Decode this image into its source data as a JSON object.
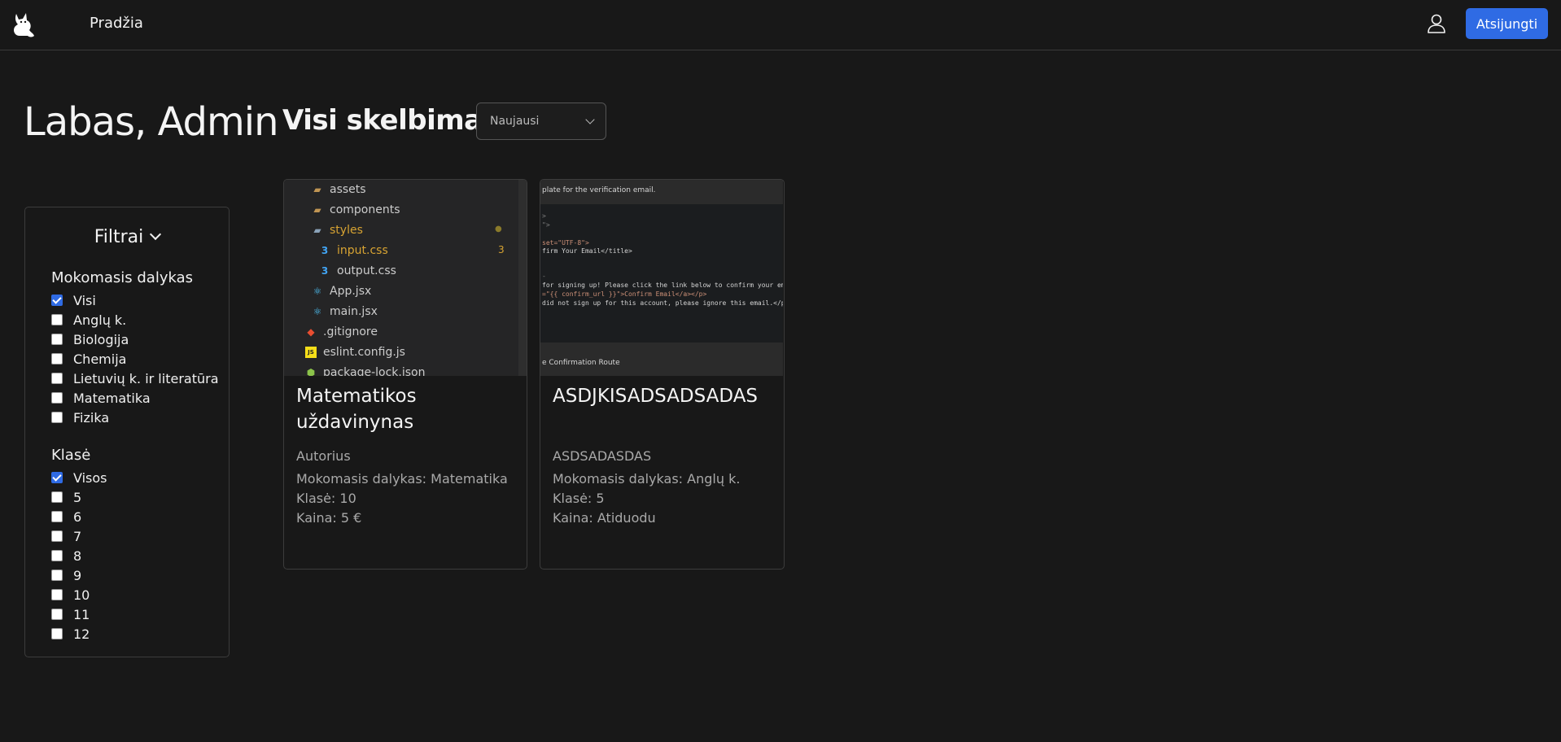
{
  "nav": {
    "home_label": "Pradžia",
    "logout_label": "Atsijungti"
  },
  "greeting": "Labas, Admin",
  "filters": {
    "title": "Filtrai",
    "subject_group": {
      "title": "Mokomasis dalykas",
      "options": [
        {
          "label": "Visi",
          "checked": true
        },
        {
          "label": "Anglų k.",
          "checked": false
        },
        {
          "label": "Biologija",
          "checked": false
        },
        {
          "label": "Chemija",
          "checked": false
        },
        {
          "label": "Lietuvių k. ir literatūra",
          "checked": false
        },
        {
          "label": "Matematika",
          "checked": false
        },
        {
          "label": "Fizika",
          "checked": false
        }
      ]
    },
    "grade_group": {
      "title": "Klasė",
      "options": [
        {
          "label": "Visos",
          "checked": true
        },
        {
          "label": "5",
          "checked": false
        },
        {
          "label": "6",
          "checked": false
        },
        {
          "label": "7",
          "checked": false
        },
        {
          "label": "8",
          "checked": false
        },
        {
          "label": "9",
          "checked": false
        },
        {
          "label": "10",
          "checked": false
        },
        {
          "label": "11",
          "checked": false
        },
        {
          "label": "12",
          "checked": false
        }
      ]
    }
  },
  "listings": {
    "title": "Visi skelbimai",
    "sort_value": "Naujausi",
    "cards": [
      {
        "title": "Matematikos uždavinynas",
        "author": "Autorius",
        "subject": "Mokomasis dalykas: Matematika",
        "grade": "Klasė: 10",
        "price": "Kaina: 5 €",
        "image": {
          "rows": [
            {
              "name": "assets",
              "icon": "folder-icon"
            },
            {
              "name": "components",
              "icon": "folder-icon"
            },
            {
              "name": "styles",
              "icon": "folder-icon",
              "badge": "●"
            },
            {
              "name": "input.css",
              "icon": "css-icon",
              "badge": "3"
            },
            {
              "name": "output.css",
              "icon": "css-icon"
            },
            {
              "name": "App.jsx",
              "icon": "react-icon"
            },
            {
              "name": "main.jsx",
              "icon": "react-icon"
            },
            {
              "name": ".gitignore",
              "icon": "git-icon"
            },
            {
              "name": "eslint.config.js",
              "icon": "js-icon"
            },
            {
              "name": "package-lock.json",
              "icon": "node-icon"
            }
          ]
        }
      },
      {
        "title": "ASDJKISADSADSADAS",
        "author": "ASDSADASDAS",
        "subject": "Mokomasis dalykas: Anglų k.",
        "grade": "Klasė: 5",
        "price": "Kaina: Atiduodu",
        "image": {
          "header_text": "plate for the verification email.",
          "code_lines": [
            ">",
            "\">",
            "set=\"UTF-8\">",
            "firm Your Email</title>",
            "-",
            " for signing up! Please click the link below to confirm your ema",
            "=\"{{ confirm_url }}\">Confirm Email</a></p>",
            " did not sign up for this account, please ignore this email.</p>"
          ],
          "footer_text": "e Confirmation Route"
        }
      }
    ]
  },
  "colors": {
    "background": "#181818",
    "accent": "#2f6be4",
    "border": "#3c3c3c",
    "muted_text": "#a9a9a9"
  }
}
